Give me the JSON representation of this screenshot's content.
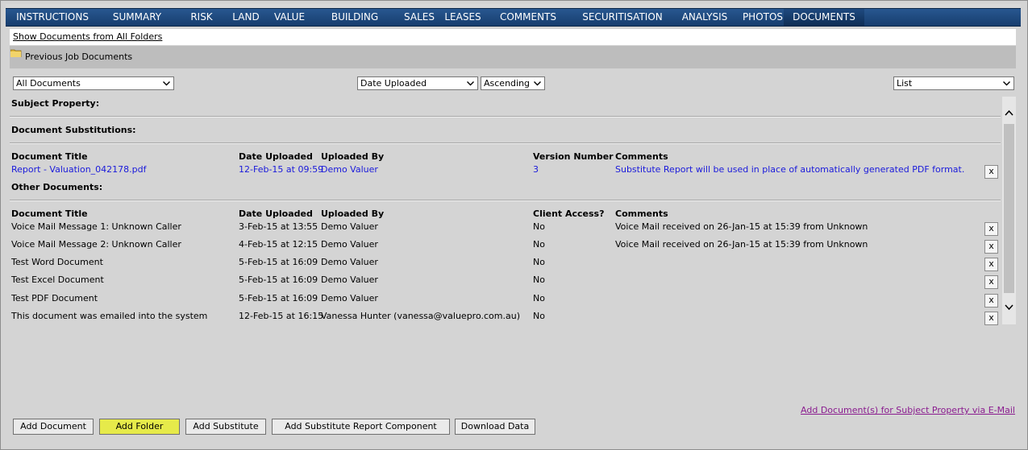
{
  "tabs": [
    {
      "label": "INSTRUCTIONS",
      "active": false
    },
    {
      "label": "SUMMARY",
      "active": false
    },
    {
      "label": "RISK",
      "active": false
    },
    {
      "label": "LAND",
      "active": false
    },
    {
      "label": "VALUE",
      "active": false
    },
    {
      "label": "BUILDING",
      "active": false
    },
    {
      "label": "SALES",
      "active": false
    },
    {
      "label": "LEASES",
      "active": false
    },
    {
      "label": "COMMENTS",
      "active": false
    },
    {
      "label": "SECURITISATION",
      "active": false
    },
    {
      "label": "ANALYSIS",
      "active": false
    },
    {
      "label": "PHOTOS",
      "active": false
    },
    {
      "label": "DOCUMENTS",
      "active": true
    }
  ],
  "show_all_link": "Show Documents from All Folders",
  "folder": {
    "label": "Previous Job Documents",
    "icon": "folder-icon"
  },
  "filters": {
    "category": "All Documents",
    "sort_by": "Date Uploaded",
    "order": "Ascending",
    "view": "List"
  },
  "sections": {
    "subject_property": "Subject Property:",
    "substitutions": "Document Substitutions:",
    "other": "Other Documents:"
  },
  "substitution_table": {
    "headers": {
      "title": "Document Title",
      "date": "Date Uploaded",
      "by": "Uploaded By",
      "version": "Version Number",
      "comments": "Comments"
    },
    "rows": [
      {
        "title": "Report - Valuation_042178.pdf",
        "date": "12-Feb-15 at 09:59",
        "by": "Demo Valuer",
        "version": "3",
        "comments": "Substitute Report will be used in place of automatically generated PDF format."
      }
    ]
  },
  "other_table": {
    "headers": {
      "title": "Document Title",
      "date": "Date Uploaded",
      "by": "Uploaded By",
      "access": "Client Access?",
      "comments": "Comments"
    },
    "rows": [
      {
        "title": "Voice Mail Message 1: Unknown Caller",
        "date": "3-Feb-15 at 13:55",
        "by": "Demo Valuer",
        "access": "No",
        "comments": "Voice Mail received on 26-Jan-15 at 15:39 from Unknown"
      },
      {
        "title": "Voice Mail Message 2: Unknown Caller",
        "date": "4-Feb-15 at 12:15",
        "by": "Demo Valuer",
        "access": "No",
        "comments": "Voice Mail received on 26-Jan-15 at 15:39 from Unknown"
      },
      {
        "title": "Test Word Document",
        "date": "5-Feb-15 at 16:09",
        "by": "Demo Valuer",
        "access": "No",
        "comments": ""
      },
      {
        "title": "Test Excel Document",
        "date": "5-Feb-15 at 16:09",
        "by": "Demo Valuer",
        "access": "No",
        "comments": ""
      },
      {
        "title": "Test PDF Document",
        "date": "5-Feb-15 at 16:09",
        "by": "Demo Valuer",
        "access": "No",
        "comments": ""
      },
      {
        "title": "This document was emailed into the system",
        "date": "12-Feb-15 at 16:15",
        "by": "Vanessa Hunter (vanessa@valuepro.com.au)",
        "access": "No",
        "comments": ""
      }
    ]
  },
  "delete_label": "x",
  "email_link": "Add Document(s) for Subject Property via E-Mail",
  "buttons": {
    "add_document": "Add Document",
    "add_folder": "Add Folder",
    "add_substitute": "Add Substitute",
    "add_substitute_component": "Add Substitute Report Component",
    "download_data": "Download Data"
  },
  "colors": {
    "tab_bg": "#1f4a80",
    "link_blue": "#1a1adb",
    "highlight": "#e6ea4a",
    "email_link": "#8a1c8f"
  }
}
